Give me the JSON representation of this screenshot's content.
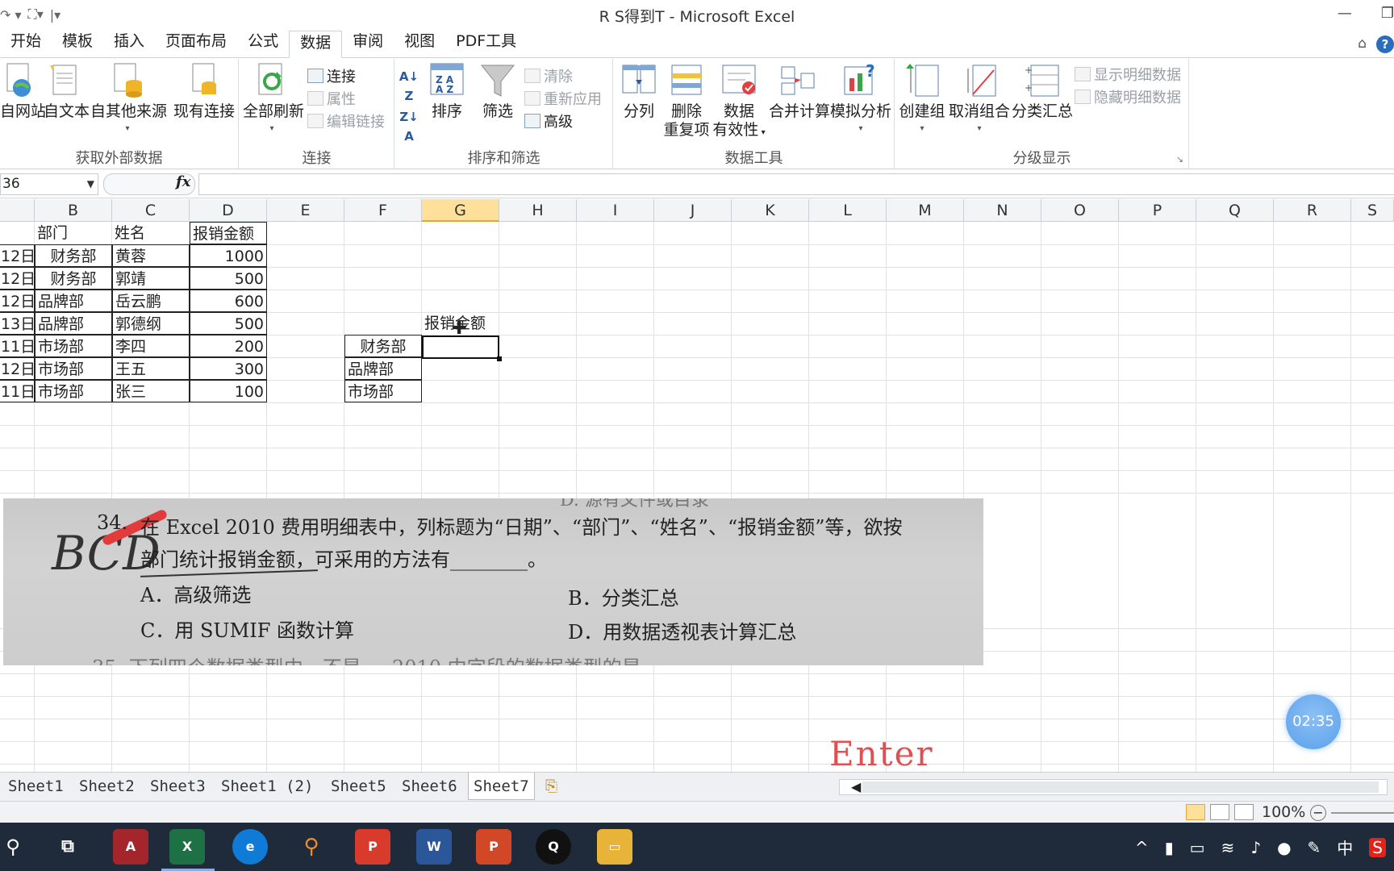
{
  "window": {
    "title": "R S得到T - Microsoft Excel"
  },
  "menu_tabs": [
    "开始",
    "模板",
    "插入",
    "页面布局",
    "公式",
    "数据",
    "审阅",
    "视图",
    "PDF工具"
  ],
  "active_tab": "数据",
  "ribbon": {
    "group_external": {
      "label": "获取外部数据",
      "from_web": "自网站",
      "from_text": "自文本",
      "from_other": "自其他来源",
      "existing": "现有连接"
    },
    "group_connections": {
      "label": "连接",
      "refresh_all": "全部刷新",
      "connections": "连接",
      "properties": "属性",
      "edit_links": "编辑链接"
    },
    "group_sort": {
      "label": "排序和筛选",
      "sort": "排序",
      "filter": "筛选",
      "clear": "清除",
      "reapply": "重新应用",
      "advanced": "高级"
    },
    "group_tools": {
      "label": "数据工具",
      "text_to_columns": "分列",
      "remove_dup_1": "删除",
      "remove_dup_2": "重复项",
      "validation_1": "数据",
      "validation_2": "有效性",
      "consolidate": "合并计算",
      "whatif": "模拟分析"
    },
    "group_outline": {
      "label": "分级显示",
      "group": "创建组",
      "ungroup": "取消组合",
      "subtotal": "分类汇总",
      "show_detail": "显示明细数据",
      "hide_detail": "隐藏明细数据"
    }
  },
  "formula_bar": {
    "name_box": "36",
    "fx": "fx",
    "content": ""
  },
  "columns": [
    "B",
    "C",
    "D",
    "E",
    "F",
    "G",
    "H",
    "I",
    "J",
    "K",
    "L",
    "M",
    "N",
    "O",
    "P",
    "Q",
    "R",
    "S"
  ],
  "selected_column": "G",
  "table": {
    "headers": [
      "部门",
      "姓名",
      "报销金额"
    ],
    "rows": [
      {
        "date": "12日",
        "dept": "财务部",
        "name": "黄蓉",
        "amount": "1000"
      },
      {
        "date": "12日",
        "dept": "财务部",
        "name": "郭靖",
        "amount": "500"
      },
      {
        "date": "12日",
        "dept": "品牌部",
        "name": "岳云鹏",
        "amount": "600"
      },
      {
        "date": "13日",
        "dept": "品牌部",
        "name": "郭德纲",
        "amount": "500"
      },
      {
        "date": "11日",
        "dept": "市场部",
        "name": "李四",
        "amount": "200"
      },
      {
        "date": "12日",
        "dept": "市场部",
        "name": "王五",
        "amount": "300"
      },
      {
        "date": "11日",
        "dept": "市场部",
        "name": "张三",
        "amount": "100"
      }
    ]
  },
  "summary": {
    "header": "报销金额",
    "depts": [
      "财务部",
      "品牌部",
      "市场部"
    ]
  },
  "photo": {
    "top_faded": "D. 源有文件或目录",
    "q_number": "34.",
    "q_line1": "在 Excel 2010 费用明细表中，列标题为“日期”、“部门”、“姓名”、“报销金额”等，欲按",
    "q_line2": "部门统计报销金额，可采用的方法有________。",
    "opt_a": "A．高级筛选",
    "opt_b": "B．分类汇总",
    "opt_c": "C．用 SUMIF 函数计算",
    "opt_d": "D．用数据透视表计算汇总",
    "next_faded": "35. 下列四个数据类型中，不是 ... 2010 中字段的数据类型的是",
    "handwriting": "BCD"
  },
  "timer": "02:35",
  "key_label": "Enter",
  "sheets": [
    "Sheet1",
    "Sheet2",
    "Sheet3",
    "Sheet1 (2)",
    "Sheet5",
    "Sheet6",
    "Sheet7"
  ],
  "active_sheet": "Sheet7",
  "status": {
    "zoom": "100%"
  },
  "tray": {
    "ime": "中"
  }
}
